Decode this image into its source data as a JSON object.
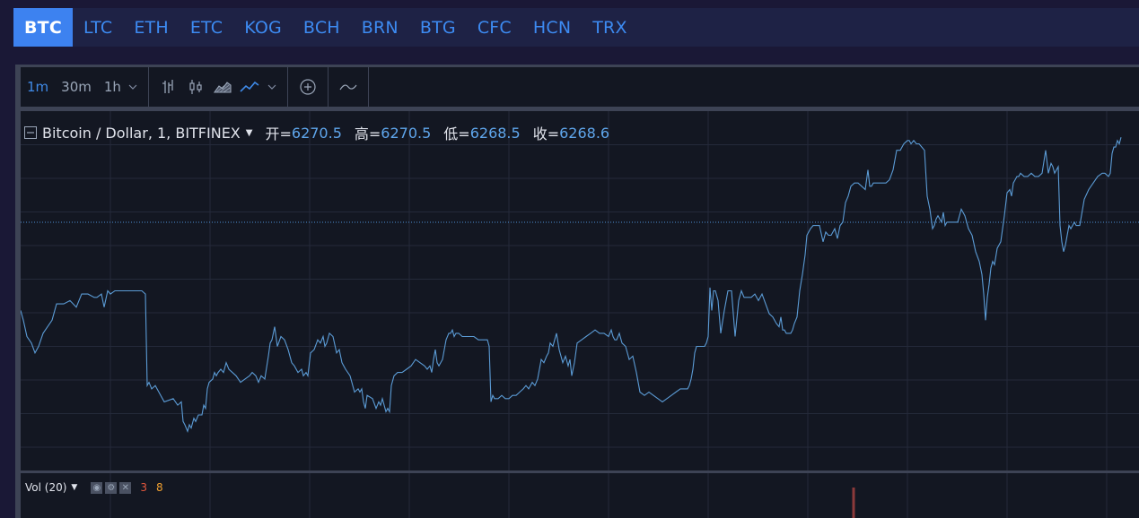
{
  "tabs": [
    "BTC",
    "LTC",
    "ETH",
    "ETC",
    "KOG",
    "BCH",
    "BRN",
    "BTG",
    "CFC",
    "HCN",
    "TRX"
  ],
  "active_tab": "BTC",
  "toolbar": {
    "timeframes": [
      "1m",
      "30m",
      "1h"
    ],
    "active_timeframe": "1m",
    "icons": [
      "bar-chart-icon",
      "candlestick-icon",
      "area-chart-icon",
      "line-chart-icon",
      "chevron-down-icon",
      "add-indicator-icon",
      "compare-icon"
    ]
  },
  "legend": {
    "symbol": "Bitcoin / Dollar, 1, BITFINEX",
    "open_label": "开=",
    "open": "6270.5",
    "high_label": "高=",
    "high": "6270.5",
    "low_label": "低=",
    "low": "6268.5",
    "close_label": "收=",
    "close": "6268.6"
  },
  "volume": {
    "label": "Vol (20)",
    "value_a": "3",
    "value_b": "8"
  },
  "colors": {
    "line": "#5b9bd5",
    "accent": "#3d82f0",
    "volume_bar": "#8b3a3a",
    "vol_a": "#e4573d",
    "vol_b": "#f0a030"
  },
  "chart_data": {
    "type": "line",
    "title": "Bitcoin / Dollar, 1, BITFINEX",
    "xlabel": "",
    "ylabel": "",
    "x": [
      0,
      3,
      7,
      12,
      16,
      20,
      25,
      30,
      35,
      40,
      48,
      55,
      62,
      65,
      68,
      75,
      82,
      85,
      90,
      93,
      97,
      100,
      105,
      110,
      115,
      120,
      127,
      135,
      139,
      141,
      143,
      146,
      150,
      160,
      170,
      175,
      179,
      181,
      183,
      186,
      188,
      190,
      193,
      195,
      198,
      202,
      204,
      206,
      208,
      210,
      214,
      216,
      218,
      220,
      223,
      226,
      229,
      232,
      240,
      245,
      250,
      255,
      258,
      262,
      265,
      268,
      272,
      276,
      278,
      280,
      283,
      286,
      290,
      294,
      298,
      302,
      305,
      309,
      313,
      315,
      318,
      320,
      323,
      327,
      331,
      334,
      337,
      339,
      341,
      344,
      348,
      352,
      355,
      358,
      362,
      367,
      372,
      376,
      378,
      380,
      382,
      384,
      386,
      392,
      396,
      399,
      401,
      403,
      405,
      407,
      409,
      411,
      413,
      416,
      420,
      425,
      430,
      435,
      440,
      445,
      450,
      453,
      456,
      458,
      460,
      462,
      464,
      466,
      470,
      474,
      477,
      479,
      481,
      483,
      485,
      488,
      492,
      495,
      500,
      505,
      510,
      516,
      520,
      522,
      524,
      526,
      528,
      532,
      536,
      540,
      544,
      548,
      552,
      556,
      560,
      563,
      566,
      570,
      573,
      576,
      580,
      583,
      586,
      588,
      590,
      593,
      597,
      600,
      604,
      607,
      610,
      612,
      614,
      617,
      620,
      625,
      630,
      635,
      640,
      645,
      650,
      655,
      658,
      660,
      662,
      664,
      667,
      670,
      674,
      678,
      682,
      686,
      690,
      695,
      700,
      705,
      710,
      715,
      720,
      725,
      730,
      735,
      740,
      743,
      745,
      747,
      749,
      751,
      753,
      755,
      758,
      760,
      762,
      764,
      766,
      768,
      770,
      772,
      774,
      777,
      780,
      784,
      788,
      792,
      796,
      800,
      803,
      806,
      810,
      814,
      818,
      822,
      826,
      830,
      834,
      838,
      842,
      845,
      847,
      849,
      851,
      853,
      855,
      858,
      860,
      862,
      865,
      868,
      871,
      874,
      876,
      878,
      880,
      883,
      886,
      890,
      894,
      897,
      900,
      903,
      907,
      910,
      913,
      916,
      919,
      922,
      925,
      929,
      933,
      937,
      941,
      944,
      946,
      948,
      950,
      953,
      956,
      960,
      964,
      968,
      972,
      976,
      980,
      984,
      988,
      990,
      992,
      995,
      998,
      1001,
      1004,
      1007,
      1010,
      1013,
      1016,
      1018,
      1020,
      1022,
      1024,
      1026,
      1028,
      1030,
      1032,
      1036,
      1040,
      1044,
      1048,
      1052,
      1056,
      1060,
      1064,
      1068,
      1071,
      1073,
      1075,
      1077,
      1079,
      1081,
      1083,
      1085,
      1088,
      1092,
      1096,
      1099,
      1102,
      1104,
      1106,
      1108,
      1110,
      1112,
      1114,
      1118,
      1122,
      1126,
      1130,
      1134,
      1138,
      1142,
      1145,
      1148,
      1150,
      1152,
      1154,
      1156,
      1158,
      1160,
      1162,
      1164,
      1166,
      1168,
      1170,
      1172,
      1174,
      1176,
      1178,
      1180,
      1185,
      1190,
      1195,
      1200,
      1205,
      1208,
      1212,
      1214,
      1216,
      1218,
      1220,
      1222,
      1224,
      1226
    ],
    "values": [
      6273.9,
      6273.6,
      6273.1,
      6272.9,
      6272.6,
      6272.8,
      6273.2,
      6273.4,
      6273.6,
      6274.1,
      6274.1,
      6274.2,
      6274.0,
      6274.2,
      6274.4,
      6274.4,
      6274.3,
      6274.3,
      6274.4,
      6274.0,
      6274.5,
      6274.4,
      6274.5,
      6274.5,
      6274.5,
      6274.5,
      6274.5,
      6274.5,
      6274.4,
      6271.6,
      6271.7,
      6271.5,
      6271.6,
      6271.1,
      6271.2,
      6271.0,
      6271.1,
      6270.5,
      6270.4,
      6270.2,
      6270.4,
      6270.3,
      6270.6,
      6270.5,
      6270.7,
      6270.7,
      6271.0,
      6270.9,
      6271.5,
      6271.7,
      6271.8,
      6272.0,
      6271.9,
      6272.0,
      6272.1,
      6272.0,
      6272.3,
      6272.1,
      6271.9,
      6271.7,
      6271.8,
      6271.9,
      6272.0,
      6271.9,
      6271.7,
      6271.9,
      6271.8,
      6272.5,
      6272.9,
      6273.0,
      6273.4,
      6272.8,
      6273.1,
      6273.0,
      6272.7,
      6272.3,
      6272.2,
      6272.0,
      6272.1,
      6271.9,
      6272.0,
      6271.9,
      6272.6,
      6272.7,
      6273.0,
      6272.9,
      6273.1,
      6272.8,
      6272.9,
      6273.2,
      6273.1,
      6272.6,
      6272.7,
      6272.3,
      6272.1,
      6271.9,
      6271.4,
      6271.5,
      6271.4,
      6271.5,
      6271.1,
      6270.9,
      6271.3,
      6271.2,
      6270.9,
      6271.1,
      6271.0,
      6271.2,
      6271.0,
      6270.8,
      6270.9,
      6270.8,
      6271.6,
      6271.9,
      6272.0,
      6272.0,
      6272.1,
      6272.2,
      6272.4,
      6272.3,
      6272.2,
      6272.1,
      6272.2,
      6272.0,
      6272.4,
      6272.7,
      6272.3,
      6272.2,
      6272.4,
      6273.0,
      6273.2,
      6273.2,
      6273.3,
      6273.1,
      6273.2,
      6273.2,
      6273.1,
      6273.1,
      6273.1,
      6273.1,
      6273.0,
      6273.0,
      6273.0,
      6272.8,
      6271.1,
      6271.3,
      6271.2,
      6271.2,
      6271.3,
      6271.2,
      6271.2,
      6271.3,
      6271.3,
      6271.4,
      6271.5,
      6271.6,
      6271.5,
      6271.7,
      6271.6,
      6271.8,
      6272.4,
      6272.3,
      6272.5,
      6272.6,
      6272.9,
      6272.8,
      6273.2,
      6272.7,
      6272.3,
      6272.5,
      6272.2,
      6272.4,
      6271.9,
      6272.3,
      6272.9,
      6273.0,
      6273.1,
      6273.2,
      6273.3,
      6273.2,
      6273.2,
      6273.1,
      6273.3,
      6273.1,
      6273.0,
      6273.0,
      6273.2,
      6272.9,
      6272.8,
      6272.4,
      6272.5,
      6272.0,
      6271.4,
      6271.3,
      6271.4,
      6271.3,
      6271.2,
      6271.1,
      6271.2,
      6271.3,
      6271.4,
      6271.5,
      6271.5,
      6271.5,
      6271.6,
      6271.8,
      6272.1,
      6272.6,
      6272.8,
      6272.8,
      6272.8,
      6272.8,
      6272.8,
      6272.9,
      6273.1,
      6274.6,
      6273.9,
      6274.5,
      6274.5,
      6274.2,
      6273.2,
      6273.9,
      6274.5,
      6274.5,
      6273.1,
      6274.2,
      6274.5,
      6274.3,
      6274.3,
      6274.3,
      6274.4,
      6274.2,
      6274.4,
      6274.1,
      6273.8,
      6273.7,
      6273.5,
      6273.4,
      6273.7,
      6273.3,
      6273.3,
      6273.2,
      6273.2,
      6273.2,
      6273.3,
      6273.5,
      6273.7,
      6274.5,
      6275.0,
      6275.6,
      6276.2,
      6276.3,
      6276.4,
      6276.5,
      6276.5,
      6276.5,
      6276.0,
      6276.3,
      6276.2,
      6276.2,
      6276.4,
      6276.1,
      6276.5,
      6276.6,
      6277.2,
      6277.4,
      6277.7,
      6277.8,
      6277.8,
      6277.7,
      6277.6,
      6278.2,
      6277.7,
      6277.7,
      6277.8,
      6277.8,
      6277.8,
      6277.8,
      6277.8,
      6277.9,
      6278.2,
      6278.8,
      6278.8,
      6279.0,
      6279.1,
      6279.1,
      6279.0,
      6279.1,
      6279.0,
      6279.0,
      6278.9,
      6278.8,
      6277.4,
      6277.0,
      6276.4,
      6276.5,
      6276.7,
      6276.8,
      6276.7,
      6276.6,
      6276.9,
      6276.5,
      6276.6,
      6276.6,
      6276.6,
      6276.6,
      6277.0,
      6276.8,
      6276.4,
      6276.2,
      6275.7,
      6275.4,
      6275.0,
      6274.4,
      6273.6,
      6274.3,
      6274.7,
      6275.2,
      6275.4,
      6275.3,
      6275.8,
      6276.0,
      6276.8,
      6277.5,
      6277.6,
      6277.4,
      6277.8,
      6277.9,
      6278.0,
      6278.0,
      6278.1,
      6278.0,
      6278.0,
      6278.1,
      6278.0,
      6278.0,
      6278.1,
      6278.8,
      6278.1,
      6278.4,
      6278.3,
      6278.1,
      6278.2,
      6278.3,
      6276.5,
      6276.0,
      6275.7,
      6275.9,
      6276.2,
      6276.5,
      6276.4,
      6276.5,
      6276.6,
      6276.5,
      6276.5,
      6276.5,
      6277.3,
      6277.6,
      6277.8,
      6278.0,
      6278.1,
      6278.1,
      6278.0,
      6278.1,
      6278.7,
      6278.9,
      6278.9,
      6279.1,
      6279.0,
      6279.2,
      6279.2,
      6279.2,
      6279.1,
      6279.0,
      6278.4,
      6277.7,
      6278.0,
      6277.4,
      6276.6
    ],
    "ylim": [
      6269.0,
      6280.0
    ],
    "reference_line": 6276.6,
    "grid": true,
    "volume_bars": [
      {
        "x": 928,
        "value": 8
      }
    ]
  }
}
